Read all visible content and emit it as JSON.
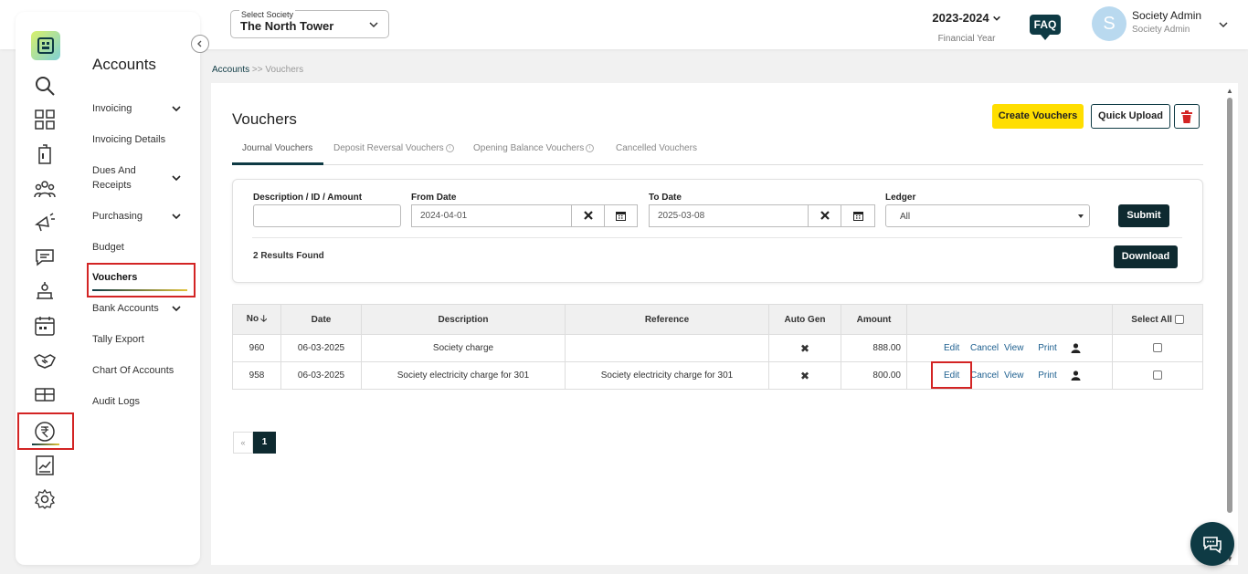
{
  "header": {
    "society_label": "Select Society",
    "society_value": "The North Tower",
    "financial_year": "2023-2024",
    "financial_year_label": "Financial Year",
    "faq": "FAQ",
    "avatar_letter": "S",
    "user_name": "Society Admin",
    "user_role": "Society Admin"
  },
  "sidebar": {
    "title": "Accounts",
    "items": [
      {
        "label": "Invoicing"
      },
      {
        "label": "Invoicing Details"
      },
      {
        "label": "Dues And Receipts"
      },
      {
        "label": "Purchasing"
      },
      {
        "label": "Budget"
      },
      {
        "label": "Vouchers"
      },
      {
        "label": "Bank Accounts"
      },
      {
        "label": "Tally Export"
      },
      {
        "label": "Chart Of Accounts"
      },
      {
        "label": "Audit Logs"
      }
    ]
  },
  "breadcrumb": {
    "root": "Accounts",
    "sep": ">>",
    "current": "Vouchers"
  },
  "page": {
    "title": "Vouchers",
    "create_label": "Create Vouchers",
    "quick_upload_label": "Quick Upload"
  },
  "tabs": [
    {
      "label": "Journal Vouchers"
    },
    {
      "label": "Deposit Reversal Vouchers"
    },
    {
      "label": "Opening Balance Vouchers"
    },
    {
      "label": "Cancelled Vouchers"
    }
  ],
  "filters": {
    "desc_label": "Description / ID / Amount",
    "desc_value": "",
    "from_label": "From Date",
    "from_value": "2024-04-01",
    "to_label": "To Date",
    "to_value": "2025-03-08",
    "ledger_label": "Ledger",
    "ledger_value": "All",
    "submit_label": "Submit",
    "results": "2 Results Found",
    "download_label": "Download"
  },
  "table": {
    "columns": [
      "No",
      "Date",
      "Description",
      "Reference",
      "Auto Gen",
      "Amount",
      "",
      "Select All"
    ],
    "rows": [
      {
        "no": "960",
        "date": "06-03-2025",
        "description": "Society charge",
        "reference": "",
        "amount": "888.00"
      },
      {
        "no": "958",
        "date": "06-03-2025",
        "description": "Society electricity charge for 301",
        "reference": "Society electricity charge for 301",
        "amount": "800.00"
      }
    ],
    "actions": {
      "edit": "Edit",
      "cancel": "Cancel",
      "view": "View",
      "print": "Print"
    }
  },
  "pagination": {
    "prev": "«",
    "current": "1"
  },
  "colors": {
    "primary": "#0e3a44",
    "accent": "#ffde00",
    "highlight": "#d32424"
  }
}
